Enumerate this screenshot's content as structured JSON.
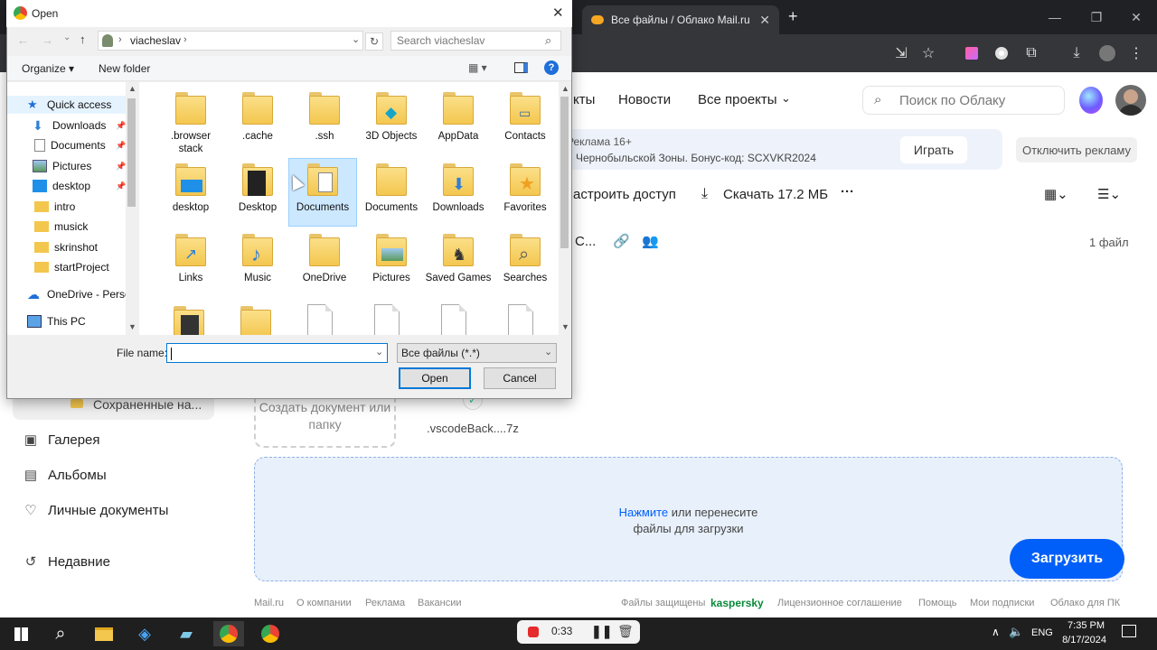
{
  "browser": {
    "tab_title": "Все файлы / Облако Mail.ru",
    "new_tab": "+"
  },
  "cloud": {
    "nav": [
      "Новости",
      "Все проекты"
    ],
    "partial_nav": "кты",
    "search_placeholder": "Поиск по Облаку",
    "ad": {
      "line1": "Реклама 16+",
      "line2": "Чернобыльской Зоны. Бонус-код: SCXVKR2024",
      "play_label": "Играть",
      "disable_label": "Отключить рекламу"
    },
    "actions": {
      "share": "астроить доступ",
      "download": "Скачать 17.2 МБ",
      "more": "···"
    },
    "folder_partial": "С...",
    "file_count": "1 файл",
    "sidebar": {
      "saved": "Сохраненные на...",
      "items": [
        "Галерея",
        "Альбомы",
        "Личные документы",
        "Недавние"
      ]
    },
    "create_label": "Создать документ или папку",
    "file_name": ".vscodeBack....7z",
    "drop_zone": {
      "link": "Нажмите",
      "rest": " или перенесите",
      "line2": "файлы для загрузки"
    },
    "upload_label": "Загрузить",
    "footer_left": [
      "Mail.ru",
      "О компании",
      "Реклама",
      "Вакансии"
    ],
    "footer_right": [
      "Файлы защищены",
      "kaspersky",
      "Лицензионное соглашение",
      "Помощь",
      "Мои подписки",
      "Облако для ПК"
    ]
  },
  "dialog": {
    "title": "Open",
    "path": [
      "viacheslav"
    ],
    "search_placeholder": "Search viacheslav",
    "organize_label": "Organize",
    "new_folder_label": "New folder",
    "nav_items": [
      {
        "label": "Quick access"
      },
      {
        "label": "Downloads",
        "pinned": true
      },
      {
        "label": "Documents",
        "pinned": true
      },
      {
        "label": "Pictures",
        "pinned": true
      },
      {
        "label": "desktop",
        "pinned": true
      },
      {
        "label": "intro"
      },
      {
        "label": "musick"
      },
      {
        "label": "skrinshot"
      },
      {
        "label": "startProject"
      },
      {
        "label": "OneDrive - Persor"
      },
      {
        "label": "This PC"
      }
    ],
    "files": [
      ".browser stack",
      ".cache",
      ".ssh",
      "3D Objects",
      "AppData",
      "Contacts",
      "desktop",
      "Desktop",
      "Documents",
      "Documents",
      "Downloads",
      "Favorites",
      "Links",
      "Music",
      "OneDrive",
      "Pictures",
      "Saved Games",
      "Searches"
    ],
    "file_name_label": "File name:",
    "file_name_value": "",
    "file_type": "Все файлы (*.*)",
    "open_label": "Open",
    "cancel_label": "Cancel"
  },
  "taskbar": {
    "rec_time": "0:33",
    "lang": "ENG",
    "time": "7:35 PM",
    "date": "8/17/2024"
  }
}
